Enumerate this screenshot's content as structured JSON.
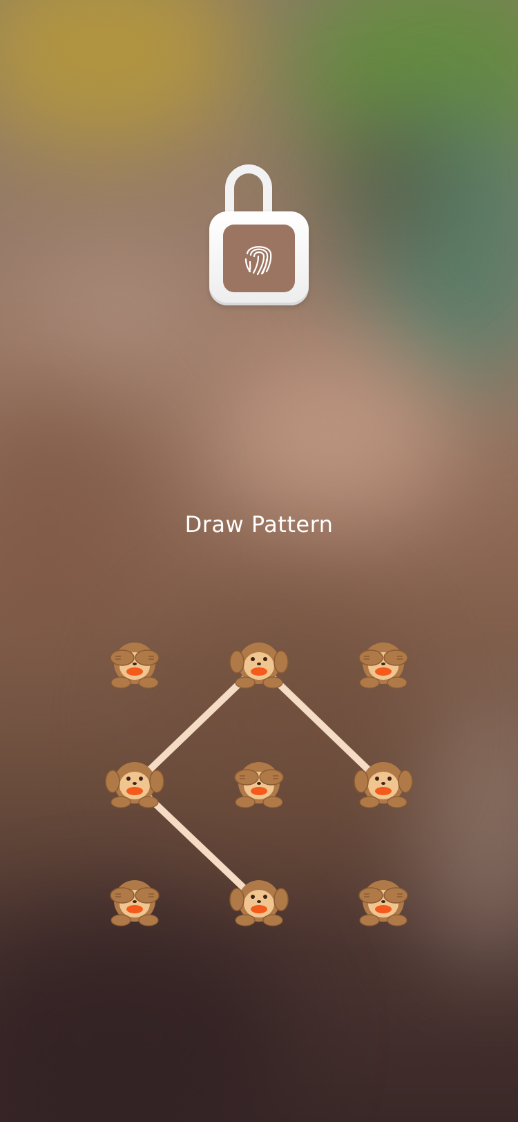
{
  "screen": {
    "prompt": "Draw Pattern"
  },
  "lock": {
    "icon": "unlocked-padlock-fingerprint-icon",
    "state": "unlocked"
  },
  "pattern": {
    "grid_rows": 3,
    "grid_cols": 3,
    "line_color": "#f6dcc4",
    "nodes": [
      {
        "row": 1,
        "col": 1,
        "icon": "see-no-evil-monkey",
        "active": false
      },
      {
        "row": 1,
        "col": 2,
        "icon": "hear-no-evil-monkey",
        "active": true
      },
      {
        "row": 1,
        "col": 3,
        "icon": "see-no-evil-monkey",
        "active": false
      },
      {
        "row": 2,
        "col": 1,
        "icon": "hear-no-evil-monkey",
        "active": true
      },
      {
        "row": 2,
        "col": 2,
        "icon": "see-no-evil-monkey",
        "active": false
      },
      {
        "row": 2,
        "col": 3,
        "icon": "hear-no-evil-monkey",
        "active": true
      },
      {
        "row": 3,
        "col": 1,
        "icon": "see-no-evil-monkey",
        "active": false
      },
      {
        "row": 3,
        "col": 2,
        "icon": "hear-no-evil-monkey",
        "active": true
      },
      {
        "row": 3,
        "col": 3,
        "icon": "see-no-evil-monkey",
        "active": false
      }
    ],
    "path": [
      {
        "row": 3,
        "col": 2
      },
      {
        "row": 2,
        "col": 1
      },
      {
        "row": 1,
        "col": 2
      },
      {
        "row": 2,
        "col": 3
      }
    ]
  },
  "colors": {
    "monkey_fur": "#b07a48",
    "monkey_face": "#f1c58f",
    "monkey_mouth": "#f35a1b",
    "text": "#ffffff"
  }
}
